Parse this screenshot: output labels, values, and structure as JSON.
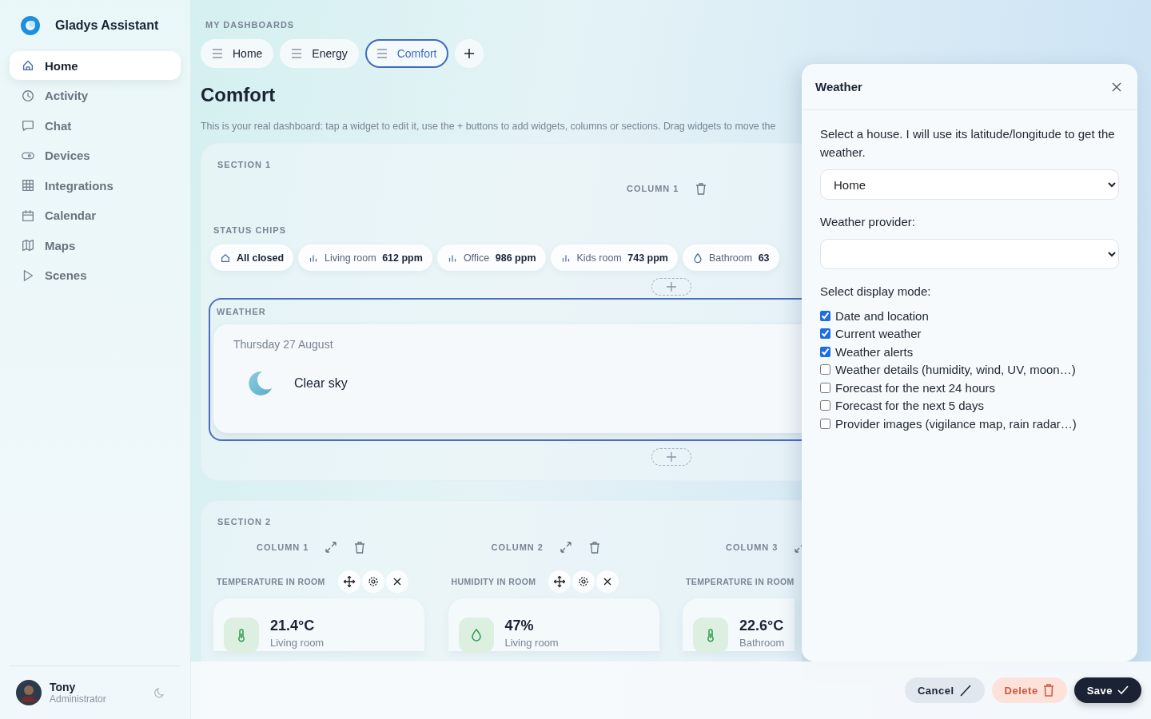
{
  "brand": {
    "name": "Gladys Assistant"
  },
  "nav": [
    {
      "label": "Home",
      "selected": true
    },
    {
      "label": "Activity",
      "selected": false
    },
    {
      "label": "Chat",
      "selected": false
    },
    {
      "label": "Devices",
      "selected": false
    },
    {
      "label": "Integrations",
      "selected": false
    },
    {
      "label": "Calendar",
      "selected": false
    },
    {
      "label": "Maps",
      "selected": false
    },
    {
      "label": "Scenes",
      "selected": false
    }
  ],
  "user": {
    "name": "Tony",
    "role": "Administrator"
  },
  "dashboards": {
    "heading": "MY DASHBOARDS",
    "tabs": [
      {
        "label": "Home",
        "selected": false
      },
      {
        "label": "Energy",
        "selected": false
      },
      {
        "label": "Comfort",
        "selected": true
      }
    ]
  },
  "title": "Comfort",
  "description": "This is your real dashboard: tap a widget to edit it, use the + buttons to add widgets, columns or sections. Drag widgets to move the",
  "section1": {
    "label": "SECTION 1",
    "column": "COLUMN 1",
    "chips_label": "STATUS CHIPS",
    "chips": [
      {
        "kind": "home",
        "label": "All closed"
      },
      {
        "kind": "co2",
        "label": "Living room",
        "value": "612 ppm"
      },
      {
        "kind": "co2",
        "label": "Office",
        "value": "986 ppm"
      },
      {
        "kind": "co2",
        "label": "Kids room",
        "value": "743 ppm"
      },
      {
        "kind": "humidity",
        "label": "Bathroom",
        "value": "63"
      }
    ],
    "weather": {
      "label": "WEATHER",
      "selected": true,
      "date": "Thursday 27 August",
      "condition": "Clear sky"
    }
  },
  "section2": {
    "label": "SECTION 2",
    "columns": [
      {
        "label": "COLUMN 1",
        "widget": {
          "title": "TEMPERATURE IN ROOM",
          "kind": "temperature",
          "value": "21.4°C",
          "room": "Living room"
        }
      },
      {
        "label": "COLUMN 2",
        "widget": {
          "title": "HUMIDITY IN ROOM",
          "kind": "humidity",
          "value": "47%",
          "room": "Living room"
        }
      },
      {
        "label": "COLUMN 3",
        "widget": {
          "title": "TEMPERATURE IN ROOM",
          "kind": "temperature",
          "value": "22.6°C",
          "room": "Bathroom"
        }
      }
    ]
  },
  "panel": {
    "title": "Weather",
    "house_label": "Select a house. I will use its latitude/longitude to get the weather.",
    "house": "Home",
    "provider_label": "Weather provider:",
    "mode_label": "Select display mode:",
    "modes": [
      {
        "label": "Date and location",
        "checked": true
      },
      {
        "label": "Current weather",
        "checked": true
      },
      {
        "label": "Weather alerts",
        "checked": true
      },
      {
        "label": "Weather details (humidity, wind, UV, moon…)",
        "checked": false
      },
      {
        "label": "Forecast for the next 24 hours",
        "checked": false
      },
      {
        "label": "Forecast for the next 5 days",
        "checked": false
      },
      {
        "label": "Provider images (vigilance map, rain radar…)",
        "checked": false
      }
    ]
  },
  "actions": [
    {
      "kind": "cancel",
      "label": "Cancel"
    },
    {
      "kind": "delete",
      "label": "Delete"
    },
    {
      "kind": "save",
      "label": "Save"
    }
  ]
}
